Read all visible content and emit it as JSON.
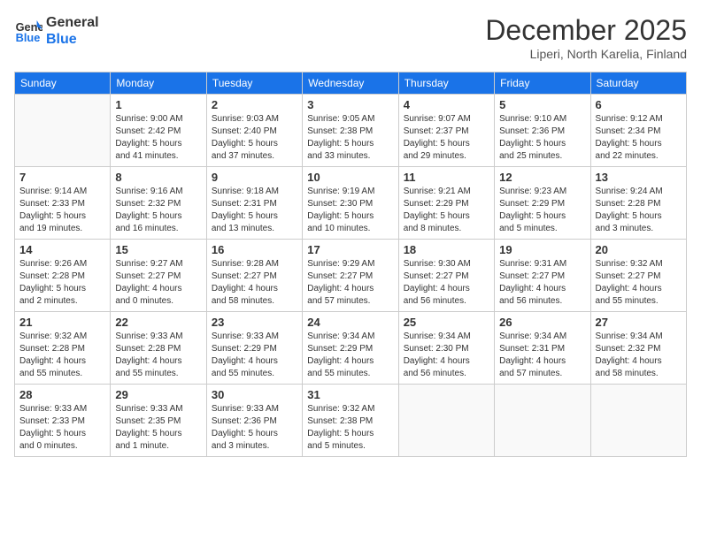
{
  "header": {
    "logo_line1": "General",
    "logo_line2": "Blue",
    "month": "December 2025",
    "location": "Liperi, North Karelia, Finland"
  },
  "weekdays": [
    "Sunday",
    "Monday",
    "Tuesday",
    "Wednesday",
    "Thursday",
    "Friday",
    "Saturday"
  ],
  "weeks": [
    [
      {
        "day": "",
        "info": ""
      },
      {
        "day": "1",
        "info": "Sunrise: 9:00 AM\nSunset: 2:42 PM\nDaylight: 5 hours\nand 41 minutes."
      },
      {
        "day": "2",
        "info": "Sunrise: 9:03 AM\nSunset: 2:40 PM\nDaylight: 5 hours\nand 37 minutes."
      },
      {
        "day": "3",
        "info": "Sunrise: 9:05 AM\nSunset: 2:38 PM\nDaylight: 5 hours\nand 33 minutes."
      },
      {
        "day": "4",
        "info": "Sunrise: 9:07 AM\nSunset: 2:37 PM\nDaylight: 5 hours\nand 29 minutes."
      },
      {
        "day": "5",
        "info": "Sunrise: 9:10 AM\nSunset: 2:36 PM\nDaylight: 5 hours\nand 25 minutes."
      },
      {
        "day": "6",
        "info": "Sunrise: 9:12 AM\nSunset: 2:34 PM\nDaylight: 5 hours\nand 22 minutes."
      }
    ],
    [
      {
        "day": "7",
        "info": "Sunrise: 9:14 AM\nSunset: 2:33 PM\nDaylight: 5 hours\nand 19 minutes."
      },
      {
        "day": "8",
        "info": "Sunrise: 9:16 AM\nSunset: 2:32 PM\nDaylight: 5 hours\nand 16 minutes."
      },
      {
        "day": "9",
        "info": "Sunrise: 9:18 AM\nSunset: 2:31 PM\nDaylight: 5 hours\nand 13 minutes."
      },
      {
        "day": "10",
        "info": "Sunrise: 9:19 AM\nSunset: 2:30 PM\nDaylight: 5 hours\nand 10 minutes."
      },
      {
        "day": "11",
        "info": "Sunrise: 9:21 AM\nSunset: 2:29 PM\nDaylight: 5 hours\nand 8 minutes."
      },
      {
        "day": "12",
        "info": "Sunrise: 9:23 AM\nSunset: 2:29 PM\nDaylight: 5 hours\nand 5 minutes."
      },
      {
        "day": "13",
        "info": "Sunrise: 9:24 AM\nSunset: 2:28 PM\nDaylight: 5 hours\nand 3 minutes."
      }
    ],
    [
      {
        "day": "14",
        "info": "Sunrise: 9:26 AM\nSunset: 2:28 PM\nDaylight: 5 hours\nand 2 minutes."
      },
      {
        "day": "15",
        "info": "Sunrise: 9:27 AM\nSunset: 2:27 PM\nDaylight: 4 hours\nand 0 minutes."
      },
      {
        "day": "16",
        "info": "Sunrise: 9:28 AM\nSunset: 2:27 PM\nDaylight: 4 hours\nand 58 minutes."
      },
      {
        "day": "17",
        "info": "Sunrise: 9:29 AM\nSunset: 2:27 PM\nDaylight: 4 hours\nand 57 minutes."
      },
      {
        "day": "18",
        "info": "Sunrise: 9:30 AM\nSunset: 2:27 PM\nDaylight: 4 hours\nand 56 minutes."
      },
      {
        "day": "19",
        "info": "Sunrise: 9:31 AM\nSunset: 2:27 PM\nDaylight: 4 hours\nand 56 minutes."
      },
      {
        "day": "20",
        "info": "Sunrise: 9:32 AM\nSunset: 2:27 PM\nDaylight: 4 hours\nand 55 minutes."
      }
    ],
    [
      {
        "day": "21",
        "info": "Sunrise: 9:32 AM\nSunset: 2:28 PM\nDaylight: 4 hours\nand 55 minutes."
      },
      {
        "day": "22",
        "info": "Sunrise: 9:33 AM\nSunset: 2:28 PM\nDaylight: 4 hours\nand 55 minutes."
      },
      {
        "day": "23",
        "info": "Sunrise: 9:33 AM\nSunset: 2:29 PM\nDaylight: 4 hours\nand 55 minutes."
      },
      {
        "day": "24",
        "info": "Sunrise: 9:34 AM\nSunset: 2:29 PM\nDaylight: 4 hours\nand 55 minutes."
      },
      {
        "day": "25",
        "info": "Sunrise: 9:34 AM\nSunset: 2:30 PM\nDaylight: 4 hours\nand 56 minutes."
      },
      {
        "day": "26",
        "info": "Sunrise: 9:34 AM\nSunset: 2:31 PM\nDaylight: 4 hours\nand 57 minutes."
      },
      {
        "day": "27",
        "info": "Sunrise: 9:34 AM\nSunset: 2:32 PM\nDaylight: 4 hours\nand 58 minutes."
      }
    ],
    [
      {
        "day": "28",
        "info": "Sunrise: 9:33 AM\nSunset: 2:33 PM\nDaylight: 5 hours\nand 0 minutes."
      },
      {
        "day": "29",
        "info": "Sunrise: 9:33 AM\nSunset: 2:35 PM\nDaylight: 5 hours\nand 1 minute."
      },
      {
        "day": "30",
        "info": "Sunrise: 9:33 AM\nSunset: 2:36 PM\nDaylight: 5 hours\nand 3 minutes."
      },
      {
        "day": "31",
        "info": "Sunrise: 9:32 AM\nSunset: 2:38 PM\nDaylight: 5 hours\nand 5 minutes."
      },
      {
        "day": "",
        "info": ""
      },
      {
        "day": "",
        "info": ""
      },
      {
        "day": "",
        "info": ""
      }
    ]
  ]
}
